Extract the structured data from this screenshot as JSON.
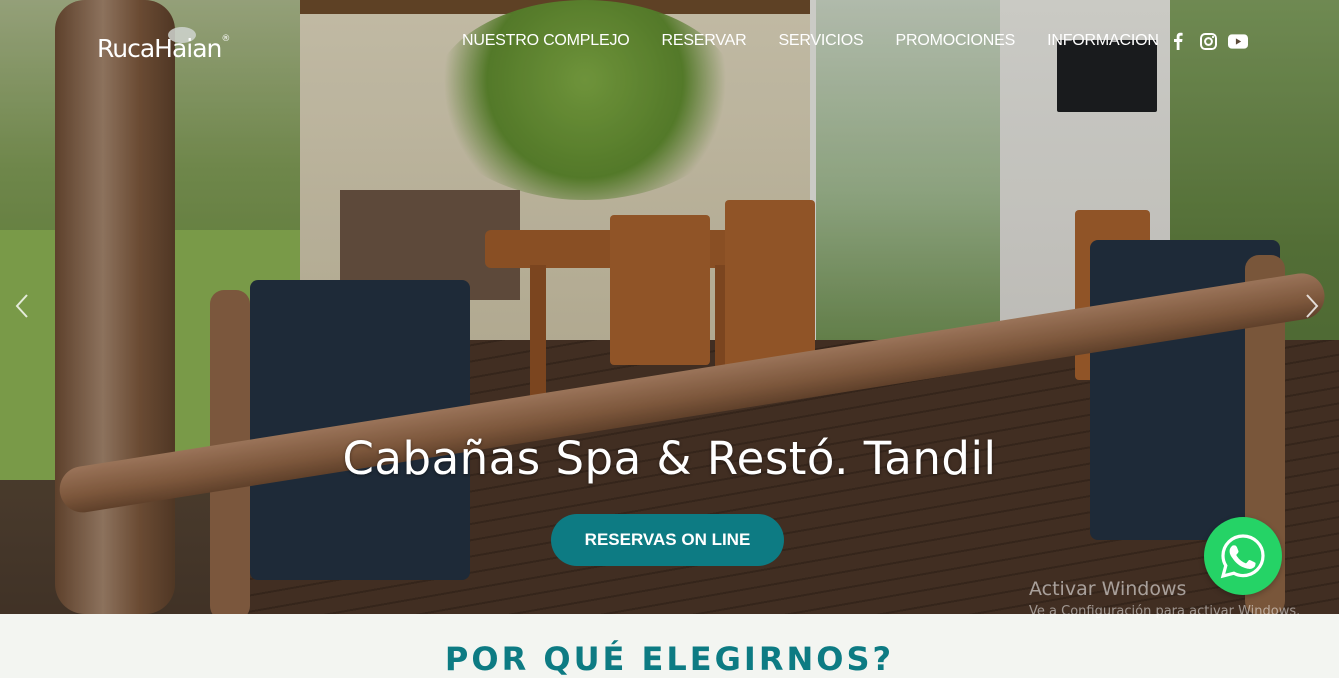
{
  "brand": {
    "name": "RucaHaian",
    "registered": "®"
  },
  "nav": {
    "items": [
      {
        "label": "NUESTRO COMPLEJO"
      },
      {
        "label": "RESERVAR"
      },
      {
        "label": "SERVICIOS"
      },
      {
        "label": "PROMOCIONES"
      },
      {
        "label": "INFORMACION"
      }
    ]
  },
  "social": {
    "icons": [
      "facebook-icon",
      "instagram-icon",
      "youtube-icon"
    ]
  },
  "hero": {
    "title": "Cabañas Spa & Restó. Tandil",
    "cta_label": "RESERVAS ON LINE"
  },
  "watermark": {
    "title": "Activar Windows",
    "subtitle": "Ve a Configuración para activar Windows."
  },
  "section": {
    "title": "POR QUÉ ELEGIRNOS?"
  },
  "colors": {
    "accent": "#0d7b83",
    "whatsapp": "#25d366"
  }
}
